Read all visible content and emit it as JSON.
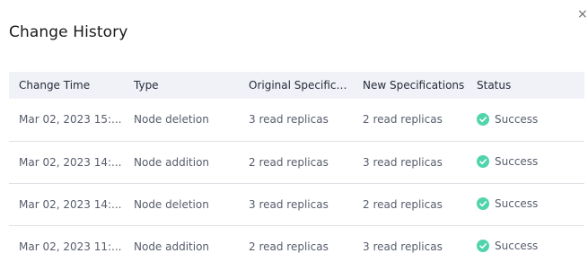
{
  "dialog": {
    "title": "Change History",
    "close_glyph": "×"
  },
  "table": {
    "columns": [
      "Change Time",
      "Type",
      "Original Specifica...",
      "New Specifications",
      "Status"
    ],
    "rows": [
      {
        "change_time": "Mar 02, 2023 15:...",
        "type": "Node deletion",
        "original": "3 read replicas",
        "new": "2 read replicas",
        "status": "Success",
        "status_icon": "success-check-icon"
      },
      {
        "change_time": "Mar 02, 2023 14:...",
        "type": "Node addition",
        "original": "2 read replicas",
        "new": "3 read replicas",
        "status": "Success",
        "status_icon": "success-check-icon"
      },
      {
        "change_time": "Mar 02, 2023 14:...",
        "type": "Node deletion",
        "original": "3 read replicas",
        "new": "2 read replicas",
        "status": "Success",
        "status_icon": "success-check-icon"
      },
      {
        "change_time": "Mar 02, 2023 11:...",
        "type": "Node addition",
        "original": "2 read replicas",
        "new": "3 read replicas",
        "status": "Success",
        "status_icon": "success-check-icon"
      }
    ]
  },
  "colors": {
    "header_bg": "#f0f2f7",
    "success": "#50d4ab",
    "row_divider": "#dfe1e6"
  }
}
